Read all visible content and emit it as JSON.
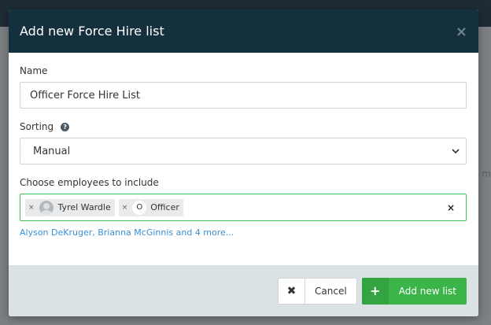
{
  "modal": {
    "title": "Add new Force Hire list",
    "close_icon": "close-icon"
  },
  "form": {
    "name_label": "Name",
    "name_value": "Officer Force Hire List",
    "sorting_label": "Sorting",
    "sorting_help_icon": "question-circle-icon",
    "sorting_value": "Manual",
    "employees_label": "Choose employees to include",
    "selected": [
      {
        "name": "Tyrel Wardle",
        "avatar": "person-avatar"
      },
      {
        "initial": "O",
        "name": "Officer"
      }
    ],
    "more_text": "Alyson DeKruger, Brianna McGinnis and 4 more..."
  },
  "footer": {
    "cancel_label": "Cancel",
    "add_label": "Add new list"
  },
  "colors": {
    "header_bg": "#14303f",
    "footer_bg": "#dbe2e4",
    "accent_green": "#3bb54a",
    "link_blue": "#3a8fd6"
  }
}
